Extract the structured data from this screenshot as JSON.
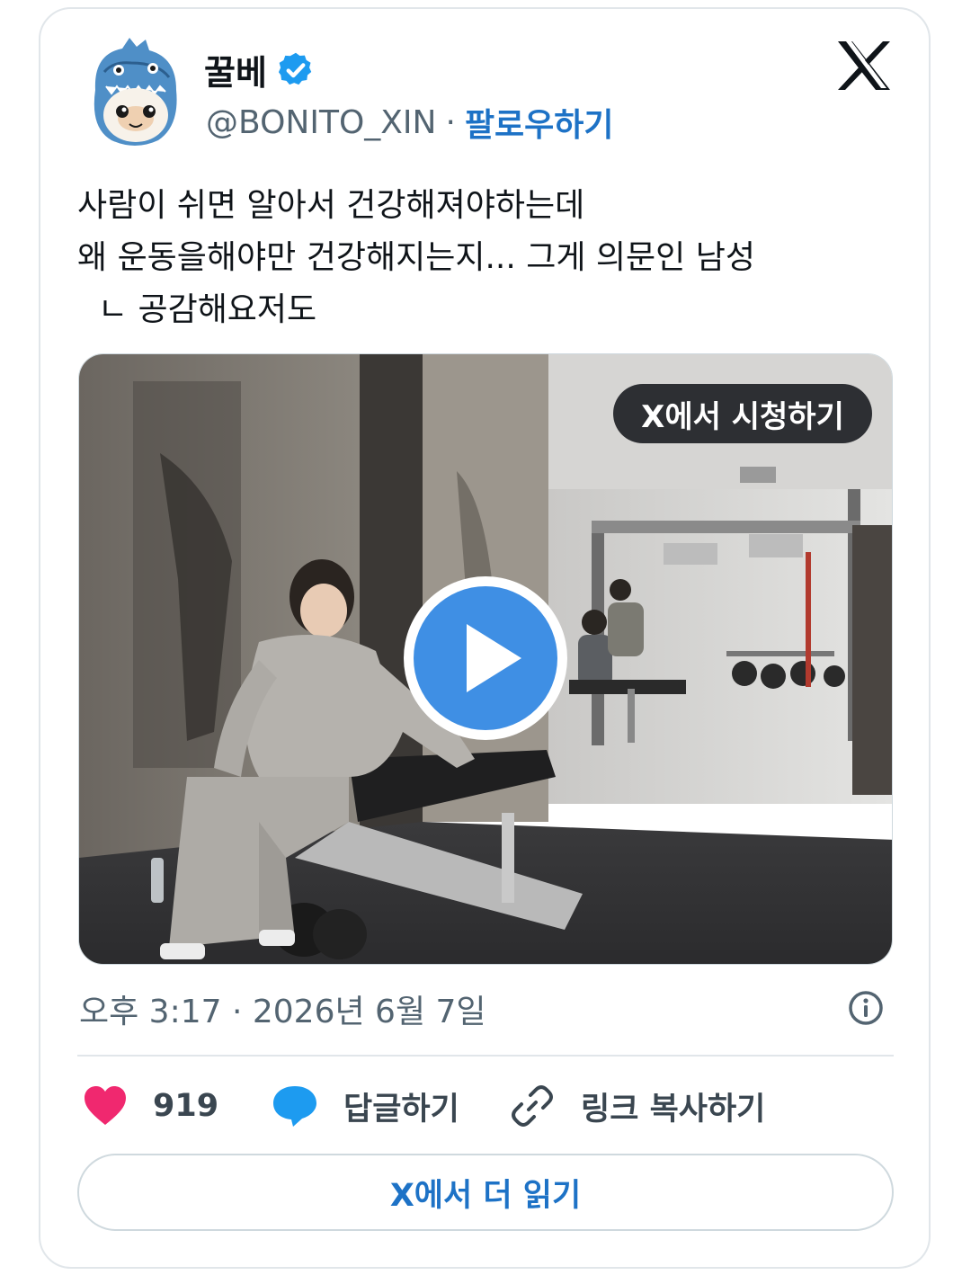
{
  "author": {
    "display_name": "꿀베",
    "handle": "@BONITO_XIN",
    "separator": "·",
    "follow_label": "팔로우하기"
  },
  "tweet": {
    "lines": [
      "사람이 쉬면 알아서 건강해져야하는데",
      "왜 운동을해야만 건강해지는지... 그게 의문인 남성",
      "  ㄴ 공감해요저도"
    ]
  },
  "media": {
    "watch_label": "X에서 시청하기"
  },
  "meta": {
    "timestamp": "오후 3:17 · 2026년 6월 7일"
  },
  "actions": {
    "likes": "919",
    "reply_label": "답글하기",
    "copy_link_label": "링크 복사하기"
  },
  "read_more_label": "X에서 더 읽기",
  "colors": {
    "accent": "#1d72c6",
    "verified": "#1d9bf0",
    "like": "#f0286f",
    "reply": "#1d9bf0",
    "text_secondary": "#536471"
  },
  "icons": [
    "verified-badge-icon",
    "x-logo-icon",
    "play-icon",
    "info-icon",
    "heart-icon",
    "reply-bubble-icon",
    "link-icon"
  ]
}
